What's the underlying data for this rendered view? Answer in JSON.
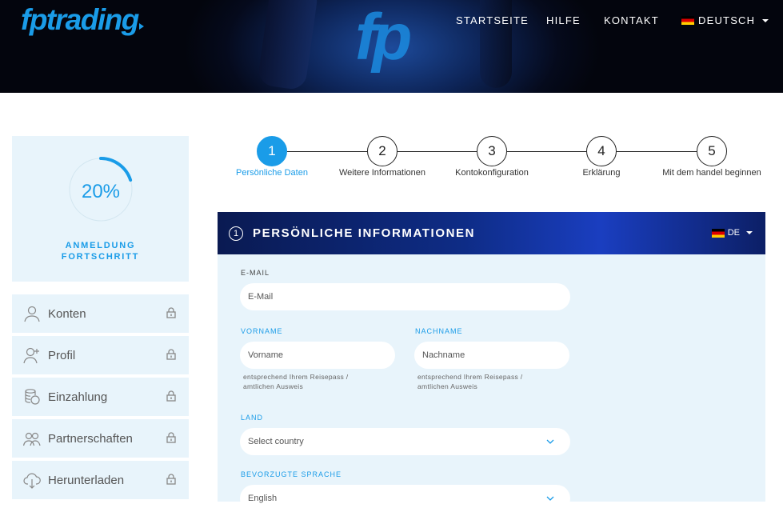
{
  "brand": {
    "logo": "fptrading",
    "hero_mark": "fp"
  },
  "nav": {
    "items": [
      "STARTSEITE",
      "HILFE",
      "KONTAKT"
    ],
    "language": "DEUTSCH"
  },
  "sidebar": {
    "progress": {
      "percent_text": "20%",
      "value": 0.2,
      "label_line1": "ANMELDUNG",
      "label_line2": "FORTSCHRITT"
    },
    "items": [
      {
        "label": "Konten",
        "icon": "user-icon"
      },
      {
        "label": "Profil",
        "icon": "user-plus-icon"
      },
      {
        "label": "Einzahlung",
        "icon": "coins-icon"
      },
      {
        "label": "Partnerschaften",
        "icon": "users-icon"
      },
      {
        "label": "Herunterladen",
        "icon": "cloud-download-icon"
      }
    ]
  },
  "steps": [
    {
      "num": "1",
      "label": "Persönliche Daten",
      "active": true
    },
    {
      "num": "2",
      "label": "Weitere Informationen",
      "active": false
    },
    {
      "num": "3",
      "label": "Kontokonfiguration",
      "active": false
    },
    {
      "num": "4",
      "label": "Erklärung",
      "active": false
    },
    {
      "num": "5",
      "label": "Mit dem handel beginnen",
      "active": false
    }
  ],
  "form": {
    "section_num": "1",
    "title": "PERSÖNLICHE INFORMATIONEN",
    "lang": "DE",
    "email": {
      "label": "E-MAIL",
      "placeholder": "E-Mail"
    },
    "firstname": {
      "label": "VORNAME",
      "placeholder": "Vorname",
      "hint": "entsprechend Ihrem Reisepass / amtlichen Ausweis"
    },
    "lastname": {
      "label": "NACHNAME",
      "placeholder": "Nachname",
      "hint": "entsprechend Ihrem Reisepass / amtlichen Ausweis"
    },
    "country": {
      "label": "LAND",
      "value": "Select country"
    },
    "language": {
      "label": "BEVORZUGTE SPRACHE",
      "value": "English"
    }
  },
  "colors": {
    "accent": "#1a9ce8",
    "panel": "#e8f4fb",
    "header_dark": "#050a1c"
  }
}
